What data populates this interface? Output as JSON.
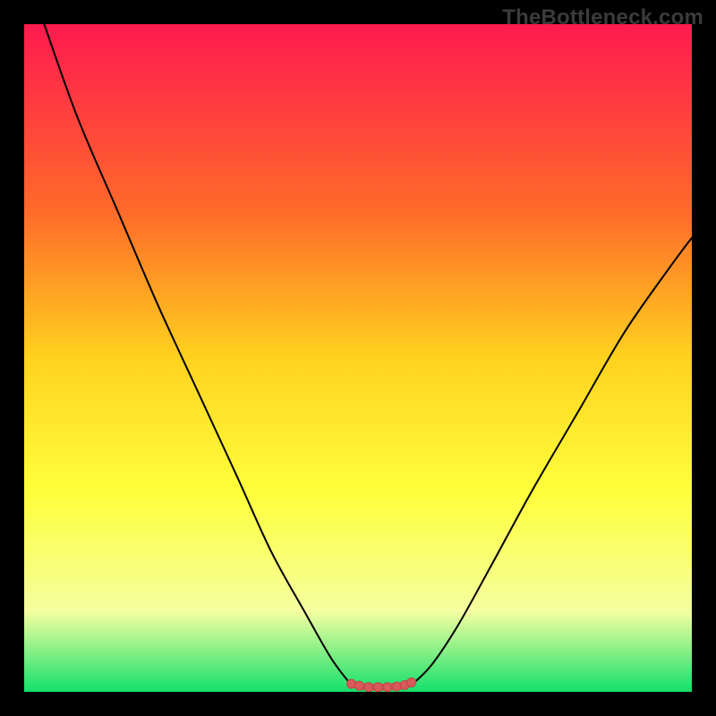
{
  "watermark": "TheBottleneck.com",
  "colors": {
    "frame": "#000000",
    "gradient_top": "#ff1a4f",
    "gradient_mid_upper": "#ff6a2a",
    "gradient_mid": "#ffd21e",
    "gradient_mid_lower": "#ffff3a",
    "gradient_lower": "#f4ffa0",
    "gradient_bottom": "#13e06b",
    "curve": "#000000",
    "marker_fill": "#d85a5a",
    "marker_line": "#c14545"
  },
  "chart_data": {
    "type": "line",
    "title": "",
    "xlabel": "",
    "ylabel": "",
    "xlim": [
      0,
      100
    ],
    "ylim": [
      0,
      100
    ],
    "series": [
      {
        "name": "left-branch",
        "x": [
          3,
          8,
          14,
          20,
          26,
          32,
          37,
          42,
          46,
          49
        ],
        "y": [
          100,
          86,
          72,
          58,
          45,
          32,
          21,
          12,
          5,
          1
        ]
      },
      {
        "name": "right-branch",
        "x": [
          58,
          61,
          65,
          70,
          76,
          83,
          90,
          97,
          100
        ],
        "y": [
          1,
          4,
          10,
          19,
          30,
          42,
          54,
          64,
          68
        ]
      },
      {
        "name": "valley-floor",
        "x": [
          49,
          51,
          53,
          55,
          57,
          58
        ],
        "y": [
          1,
          0.5,
          0.5,
          0.5,
          0.8,
          1
        ]
      }
    ],
    "markers": {
      "name": "valley-highlight",
      "x": [
        49.0,
        50.2,
        51.6,
        53.0,
        54.4,
        55.8,
        57.0,
        58.0
      ],
      "y": [
        1.2,
        0.9,
        0.7,
        0.7,
        0.7,
        0.8,
        1.0,
        1.4
      ],
      "label_text": ""
    }
  }
}
